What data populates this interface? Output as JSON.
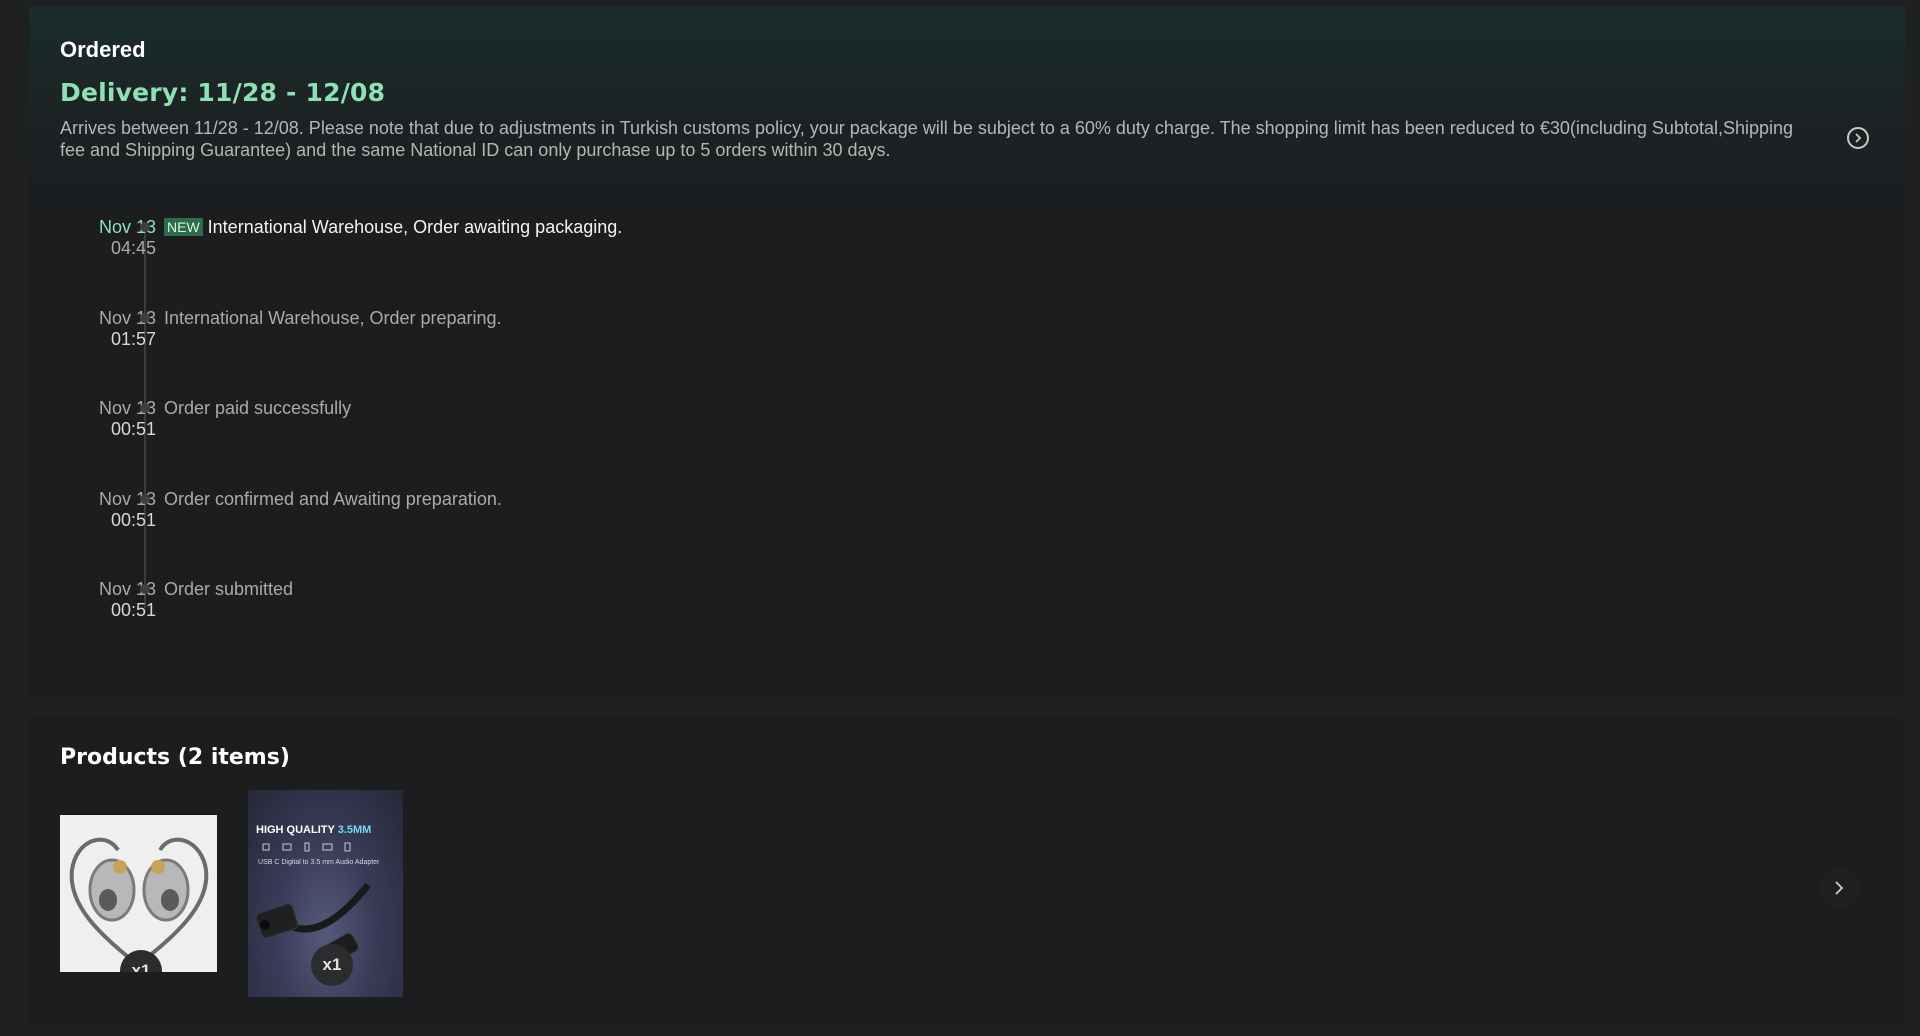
{
  "status": {
    "title": "Ordered",
    "delivery_title": "Delivery: 11/28 - 12/08",
    "description": "Arrives between 11/28 - 12/08. Please note that due to adjustments in Turkish customs policy, your package will be subject to a 60% duty charge. The shopping limit has been reduced to €30(including Subtotal,Shipping fee and Shipping Guarantee) and the same National ID can only purchase up to 5 orders within 30 days.",
    "arrow_icon": "chevron-right-circle-icon",
    "new_badge": "NEW"
  },
  "timeline": [
    {
      "date": "Nov 13",
      "time": "04:45",
      "text": "International Warehouse, Order awaiting packaging.",
      "current": true
    },
    {
      "date": "Nov 13",
      "time": "01:57",
      "text": "International Warehouse, Order preparing.",
      "current": false
    },
    {
      "date": "Nov 13",
      "time": "00:51",
      "text": "Order paid successfully",
      "current": false
    },
    {
      "date": "Nov 13",
      "time": "00:51",
      "text": "Order confirmed and Awaiting preparation.",
      "current": false
    },
    {
      "date": "Nov 13",
      "time": "00:51",
      "text": "Order submitted",
      "current": false
    }
  ],
  "products": {
    "title": "Products (2 items)",
    "items": [
      {
        "name": "in-ear earphones",
        "qty": "x1"
      },
      {
        "name": "usb-c audio adapter",
        "qty": "x1",
        "caption_main": "HIGH QUALITY ",
        "caption_accent": "3.5MM",
        "caption_sub": "USB C Digital to 3.5 mm Audio Adapter"
      }
    ],
    "next_icon": "chevron-right-icon"
  },
  "colors": {
    "accent_green": "#8fe0b5",
    "new_badge_bg": "#2d6b4b",
    "card_bg": "#1b1d1f",
    "page_bg": "#1f2120"
  }
}
